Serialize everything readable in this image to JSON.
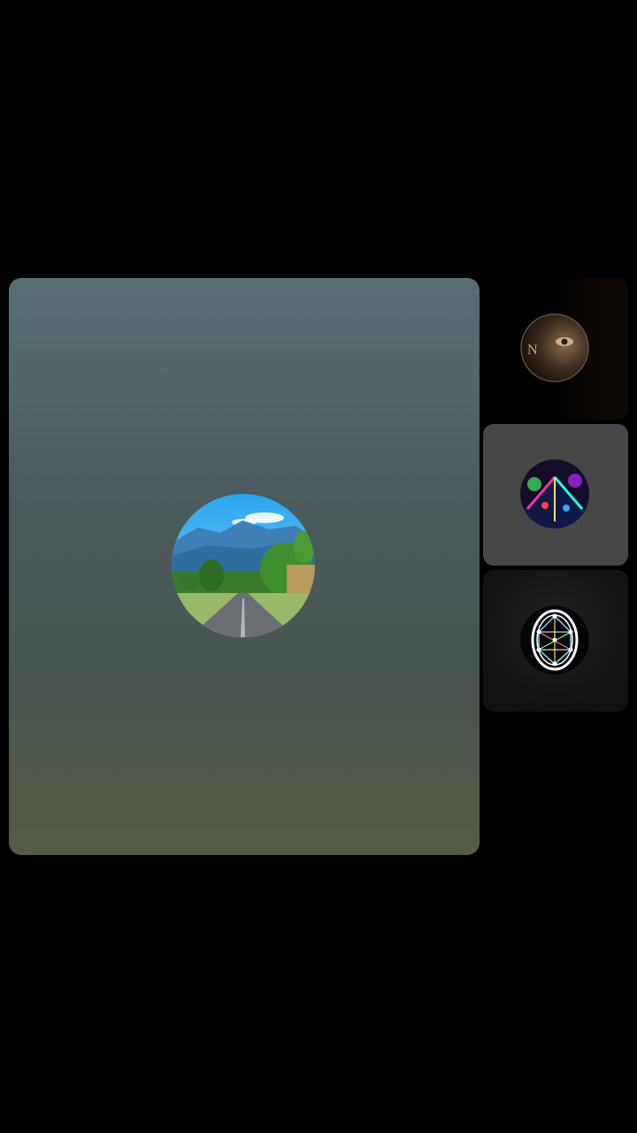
{
  "participants": [
    {
      "icon": "landscape-road-avatar-icon",
      "active": true
    },
    {
      "icon": "eye-face-avatar-icon"
    },
    {
      "icon": "neon-lights-avatar-icon",
      "highlighted": true
    },
    {
      "icon": "sacred-geometry-avatar-icon"
    }
  ],
  "colors": {
    "background": "#000000",
    "main_card_top": "#586f73",
    "main_card_bottom": "#555c46",
    "highlight_tile": "#474747",
    "dark_tile": "#141414"
  }
}
